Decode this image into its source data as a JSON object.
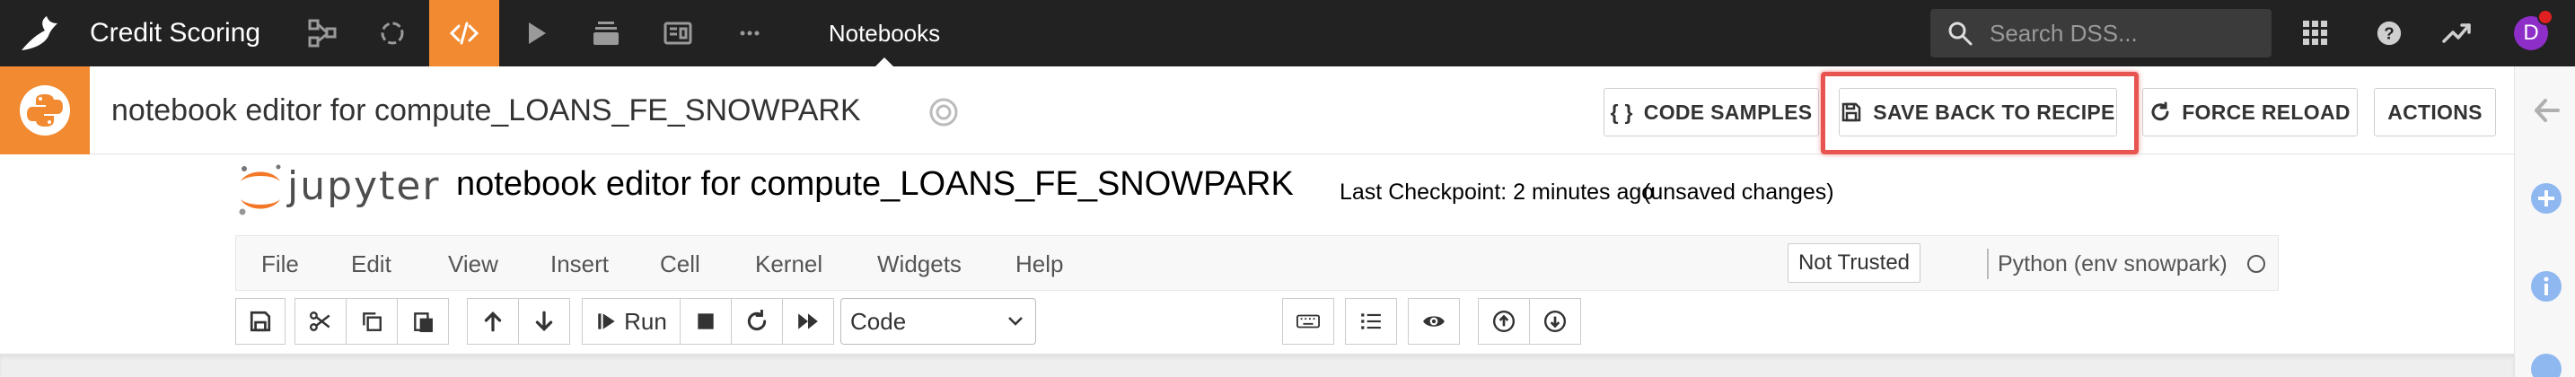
{
  "topnav": {
    "project_name": "Credit Scoring",
    "notebooks_label": "Notebooks",
    "search_placeholder": "Search DSS...",
    "avatar_initial": "D",
    "accent_color": "#f18a31",
    "icons": [
      "flow-icon",
      "lab-icon",
      "code-icon",
      "run-icon",
      "deploy-icon",
      "dashboard-icon",
      "more-icon"
    ],
    "right_icons": [
      "apps-grid-icon",
      "help-icon",
      "activity-icon"
    ]
  },
  "header": {
    "notebook_title": "notebook editor for compute_LOANS_FE_SNOWPARK",
    "buttons": {
      "code_samples": "CODE SAMPLES",
      "save_back": "SAVE BACK TO RECIPE",
      "force_reload": "FORCE RELOAD",
      "actions": "ACTIONS"
    },
    "code_samples_icon": "{ }"
  },
  "jupyter": {
    "logo_text": "jupyter",
    "title": "notebook editor for compute_LOANS_FE_SNOWPARK",
    "checkpoint": "Last Checkpoint: 2 minutes ago",
    "unsaved": "(unsaved changes)",
    "menu": [
      "File",
      "Edit",
      "View",
      "Insert",
      "Cell",
      "Kernel",
      "Widgets",
      "Help"
    ],
    "trusted": "Not Trusted",
    "kernel": "Python (env snowpark)",
    "toolbar": {
      "run_label": "Run",
      "cell_type": "Code"
    }
  },
  "right_rail": {
    "icons": [
      "collapse-arrow-icon",
      "add-icon",
      "info-icon",
      "help-icon"
    ]
  }
}
